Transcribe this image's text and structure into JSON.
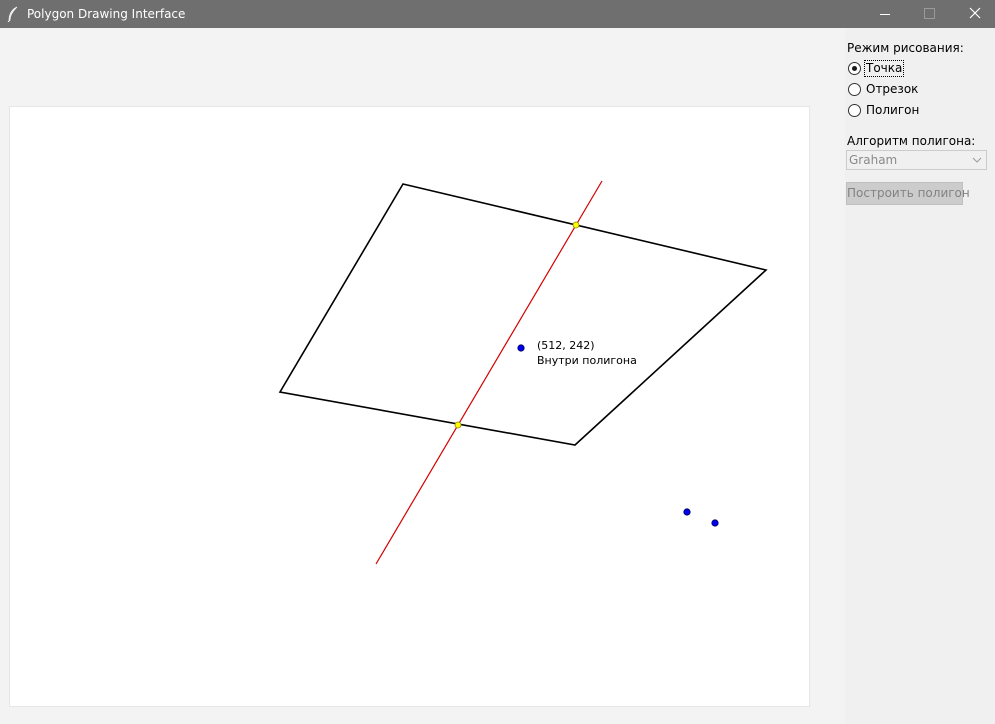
{
  "window": {
    "title": "Polygon Drawing Interface",
    "icon": "feather-icon",
    "controls": [
      "minimize-icon",
      "maximize-icon",
      "close-icon"
    ]
  },
  "panel": {
    "mode_label": "Режим рисования:",
    "modes": [
      {
        "label": "Точка",
        "selected": true
      },
      {
        "label": "Отрезок",
        "selected": false
      },
      {
        "label": "Полигон",
        "selected": false
      }
    ],
    "algorithm_label": "Алгоритм полигона:",
    "algorithm_value": "Graham",
    "build_button": "Построить полигон"
  },
  "canvas": {
    "hover_point": {
      "coords": "(512, 242)",
      "status": "Внутри полигона"
    }
  },
  "colors": {
    "polygon_stroke": "#000000",
    "segment": "#d40000",
    "point_fill": "#0000ee",
    "intersection_fill": "#ffff00",
    "titlebar": "#6f6f6f"
  }
}
